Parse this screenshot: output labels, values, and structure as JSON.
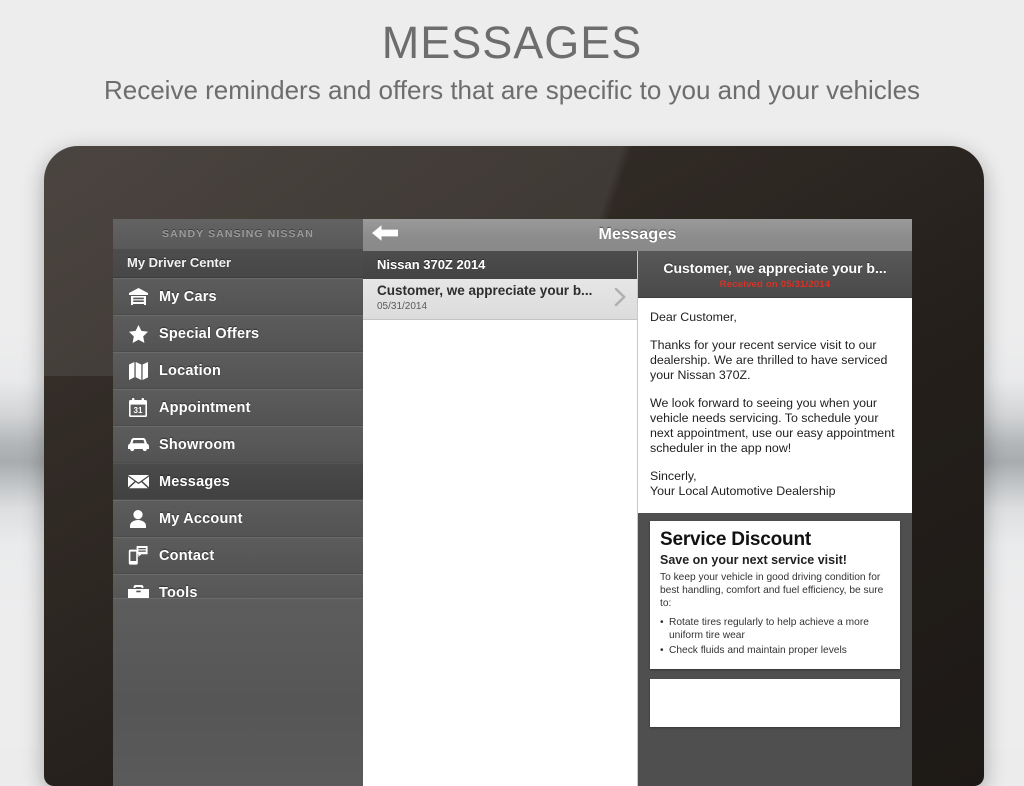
{
  "page": {
    "title": "MESSAGES",
    "subtitle": "Receive reminders and offers that are specific to you and your vehicles"
  },
  "sidebar": {
    "dealer_name": "SANDY SANSING NISSAN",
    "section_label": "My Driver Center",
    "items": [
      {
        "label": "My Cars",
        "icon": "garage-icon",
        "active": false
      },
      {
        "label": "Special Offers",
        "icon": "star-icon",
        "active": false
      },
      {
        "label": "Location",
        "icon": "map-icon",
        "active": false
      },
      {
        "label": "Appointment",
        "icon": "calendar-icon",
        "active": false
      },
      {
        "label": "Showroom",
        "icon": "car-icon",
        "active": false
      },
      {
        "label": "Messages",
        "icon": "envelope-icon",
        "active": true
      },
      {
        "label": "My Account",
        "icon": "person-icon",
        "active": false
      },
      {
        "label": "Contact",
        "icon": "phone-chat-icon",
        "active": false
      },
      {
        "label": "Tools",
        "icon": "toolbox-icon",
        "active": false
      }
    ]
  },
  "topbar": {
    "title": "Messages",
    "back_icon": "back-arrow-icon"
  },
  "message_list": {
    "group_header": "Nissan 370Z 2014",
    "rows": [
      {
        "subject": "Customer, we appreciate your b...",
        "date": "05/31/2014",
        "chevron": "chevron-right-icon",
        "selected": true
      }
    ]
  },
  "detail": {
    "subject": "Customer, we appreciate your b...",
    "received": "Received on 05/31/2014",
    "received_color": "#d93226",
    "paragraphs": [
      "Dear Customer,",
      "Thanks for your recent service visit to our dealership. We are thrilled to have serviced your Nissan 370Z.",
      "We look forward to seeing you when your vehicle needs servicing. To schedule your next appointment, use our easy appointment scheduler in the app now!",
      "Sincerly,\nYour Local Automotive Dealership"
    ],
    "coupons": [
      {
        "title": "Service Discount",
        "tagline": "Save on your next service visit!",
        "text": "To keep your vehicle in good driving condition for best handling, comfort and fuel efficiency, be sure to:",
        "bullets": [
          "Rotate tires regularly to help achieve a more uniform tire wear",
          "Check fluids and maintain proper levels"
        ]
      }
    ]
  }
}
